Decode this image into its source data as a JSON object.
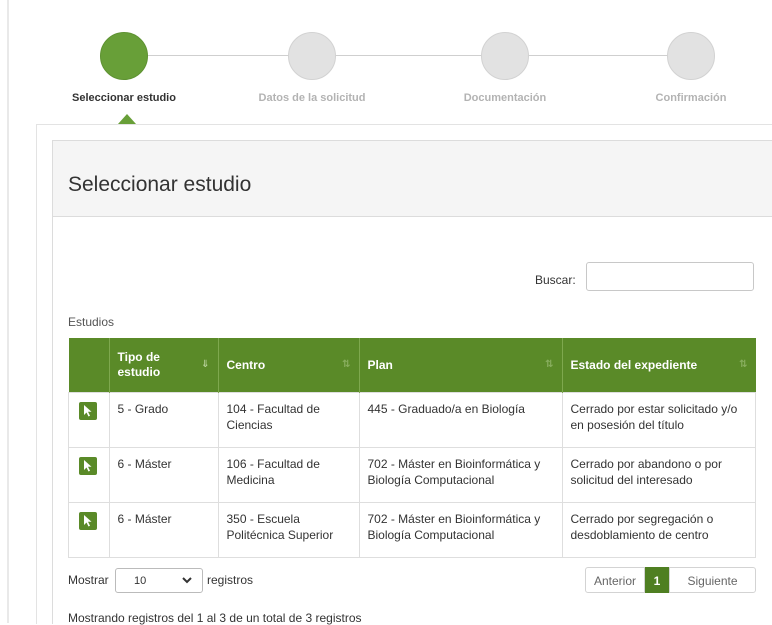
{
  "stepper": {
    "steps": [
      {
        "label": "Seleccionar estudio",
        "active": true
      },
      {
        "label": "Datos de la solicitud",
        "active": false
      },
      {
        "label": "Documentación",
        "active": false
      },
      {
        "label": "Confirmación",
        "active": false
      }
    ]
  },
  "panel": {
    "title": "Seleccionar estudio",
    "search_label": "Buscar:",
    "search_value": "",
    "caption": "Estudios"
  },
  "table": {
    "columns": [
      {
        "label": "",
        "sortable": false
      },
      {
        "label": "Tipo de estudio",
        "sortable": true,
        "sort": "active"
      },
      {
        "label": "Centro",
        "sortable": true
      },
      {
        "label": "Plan",
        "sortable": true
      },
      {
        "label": "Estado del expediente",
        "sortable": true
      }
    ],
    "rows": [
      {
        "tipo": "5 - Grado",
        "centro": "104 - Facultad de Ciencias",
        "plan": "445 - Graduado/a en Biología",
        "estado": "Cerrado por estar solicitado y/o en posesión del título"
      },
      {
        "tipo": "6 - Máster",
        "centro": "106 - Facultad de Medicina",
        "plan": "702 - Máster en Bioinformática y Biología Computacional",
        "estado": "Cerrado por abandono o por solicitud del interesado"
      },
      {
        "tipo": "6 - Máster",
        "centro": "350 - Escuela Politécnica Superior",
        "plan": "702 - Máster en Bioinformática y Biología Computacional",
        "estado": "Cerrado por segregación o desdoblamiento de centro"
      }
    ]
  },
  "footer": {
    "show_label": "Mostrar",
    "page_size": "10",
    "registros_label": "registros",
    "prev_label": "Anterior",
    "current_page": "1",
    "next_label": "Siguiente",
    "info": "Mostrando registros del 1 al 3 de un total de 3 registros"
  },
  "colors": {
    "accent": "#5a8a28",
    "active_step": "#689f38",
    "inactive_step": "#e2e2e2"
  },
  "icons": {
    "row_select": "cursor-pointer-icon",
    "sort": "sort-icon",
    "dropdown": "chevron-down-icon"
  }
}
